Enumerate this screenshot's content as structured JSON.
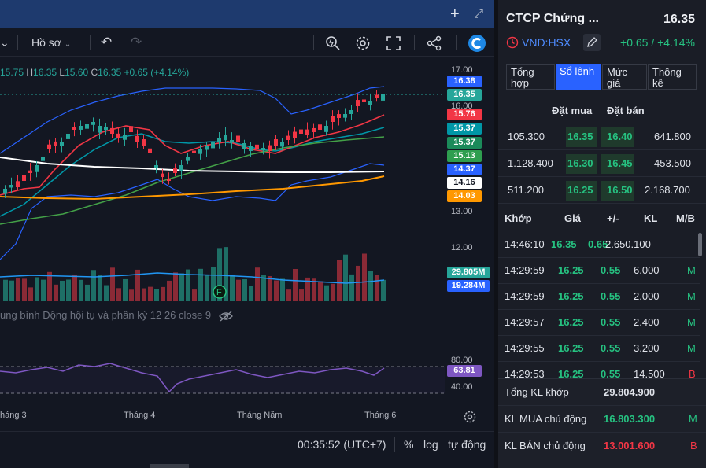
{
  "toolbar": {
    "profile_label": "Hồ sơ"
  },
  "ohlc": {
    "open": "15.75",
    "high_label": "H",
    "high": "16.35",
    "low_label": "L",
    "low": "15.60",
    "close_label": "C",
    "close": "16.35",
    "change": "+0.65 (+4.14%)"
  },
  "price_axis": {
    "ticks": [
      "17.00",
      "16.00",
      "13.00",
      "12.00",
      "80.00",
      "40.00"
    ],
    "tags": [
      {
        "text": "16.38",
        "color": "#2962ff"
      },
      {
        "text": "16.35",
        "color": "#26a69a"
      },
      {
        "text": "15.76",
        "color": "#f23645"
      },
      {
        "text": "15.37",
        "color": "#0097a7"
      },
      {
        "text": "15.37",
        "color": "#1b8a5a"
      },
      {
        "text": "15.13",
        "color": "#2e9e4f"
      },
      {
        "text": "14.37",
        "color": "#2962ff"
      },
      {
        "text": "14.16",
        "color": "#ffffff"
      },
      {
        "text": "14.03",
        "color": "#ff9800"
      },
      {
        "text": "29.805M",
        "color": "#26a69a"
      },
      {
        "text": "19.284M",
        "color": "#2962ff"
      },
      {
        "text": "63.81",
        "color": "#7e57c2"
      }
    ]
  },
  "indicator_label": "ung bình Động hội tụ và phân kỳ 12 26 close 9",
  "time_axis": [
    "háng 3",
    "Tháng 4",
    "Tháng Năm",
    "Tháng 6"
  ],
  "bottom_bar": {
    "time": "00:35:52 (UTC+7)",
    "percent": "%",
    "log": "log",
    "auto": "tự động"
  },
  "symbol": {
    "name": "CTCP Chứng ...",
    "price": "16.35",
    "exchange": "VND:HSX",
    "change": "+0.65 / +4.14%"
  },
  "tabs": [
    "Tổng hợp",
    "Sổ lệnh",
    "Mức giá",
    "Thống kê"
  ],
  "order_book": {
    "headers": [
      "Đặt mua",
      "Đặt bán"
    ],
    "rows": [
      {
        "bid_vol": "105.300",
        "bid": "16.35",
        "ask": "16.40",
        "ask_vol": "641.800"
      },
      {
        "bid_vol": "1.128.400",
        "bid": "16.30",
        "ask": "16.45",
        "ask_vol": "453.500"
      },
      {
        "bid_vol": "511.200",
        "bid": "16.25",
        "ask": "16.50",
        "ask_vol": "2.168.700"
      }
    ]
  },
  "trades": {
    "headers": [
      "Khớp",
      "Giá",
      "+/-",
      "KL",
      "M/B"
    ],
    "rows": [
      {
        "time": "14:46:10",
        "price": "16.35",
        "change": "0.65",
        "vol": "2.650.100",
        "side": ""
      },
      {
        "time": "14:29:59",
        "price": "16.25",
        "change": "0.55",
        "vol": "6.000",
        "side": "M"
      },
      {
        "time": "14:29:59",
        "price": "16.25",
        "change": "0.55",
        "vol": "2.000",
        "side": "M"
      },
      {
        "time": "14:29:57",
        "price": "16.25",
        "change": "0.55",
        "vol": "2.400",
        "side": "M"
      },
      {
        "time": "14:29:55",
        "price": "16.25",
        "change": "0.55",
        "vol": "3.200",
        "side": "M"
      },
      {
        "time": "14:29:53",
        "price": "16.25",
        "change": "0.55",
        "vol": "14.500",
        "side": "B"
      }
    ]
  },
  "summary": [
    {
      "label": "Tổng KL khớp",
      "value": "29.804.900",
      "side": ""
    },
    {
      "label": "KL MUA chủ động",
      "value": "16.803.300",
      "side": "M"
    },
    {
      "label": "KL BÁN chủ động",
      "value": "13.001.600",
      "side": "B"
    }
  ]
}
